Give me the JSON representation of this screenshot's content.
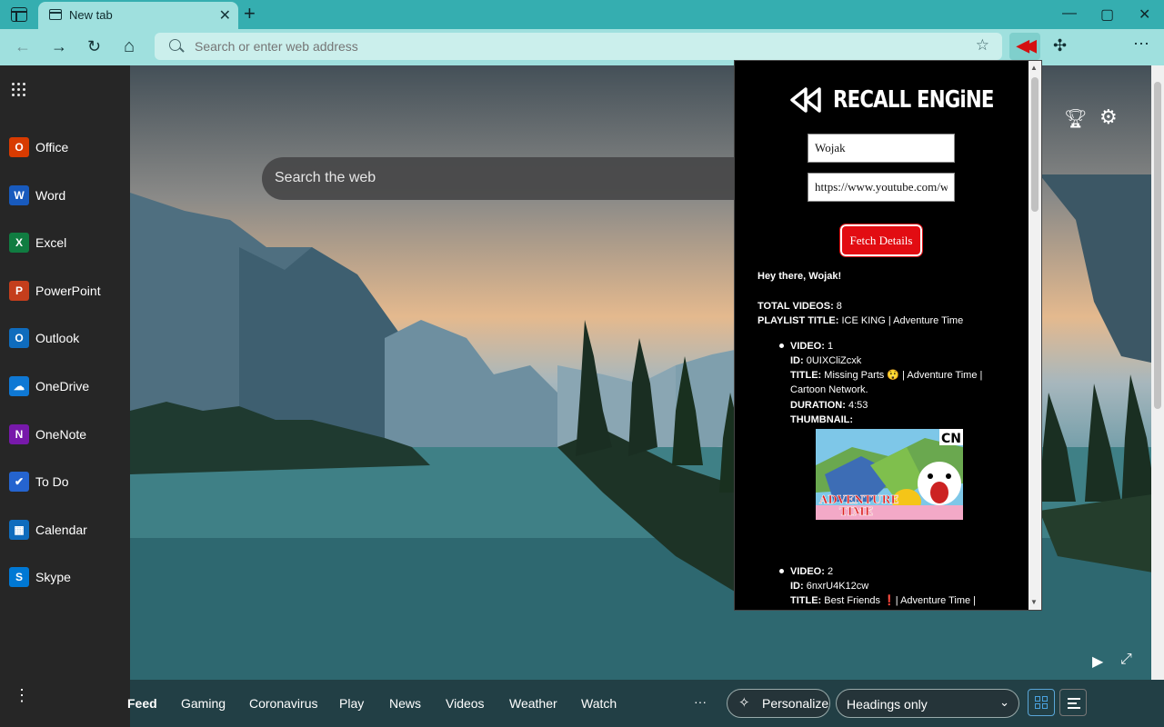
{
  "browser": {
    "tab": {
      "title": "New tab",
      "close": "✕"
    },
    "new_tab": "+",
    "window": {
      "minimize": "—",
      "maximize": "▢",
      "close": "✕"
    },
    "nav": {
      "back": "←",
      "forward": "→",
      "refresh": "↻",
      "home": "⌂"
    },
    "address_placeholder": "Search or enter web address",
    "more": "⋯"
  },
  "sidebar": {
    "apps": [
      {
        "label": "Office",
        "color": "#d83b01",
        "glyph": "O"
      },
      {
        "label": "Word",
        "color": "#185abd",
        "glyph": "W"
      },
      {
        "label": "Excel",
        "color": "#107c41",
        "glyph": "X"
      },
      {
        "label": "PowerPoint",
        "color": "#c43e1c",
        "glyph": "P"
      },
      {
        "label": "Outlook",
        "color": "#0f6cbd",
        "glyph": "O"
      },
      {
        "label": "OneDrive",
        "color": "#0f78d4",
        "glyph": "☁"
      },
      {
        "label": "OneNote",
        "color": "#7719aa",
        "glyph": "N"
      },
      {
        "label": "To Do",
        "color": "#2564cf",
        "glyph": "✔"
      },
      {
        "label": "Calendar",
        "color": "#0f6cbd",
        "glyph": "▦"
      },
      {
        "label": "Skype",
        "color": "#0078d4",
        "glyph": "S"
      }
    ]
  },
  "newtab": {
    "search_placeholder": "Search the web",
    "feed_tabs": [
      "Feed",
      "Gaming",
      "Coronavirus",
      "Play",
      "News",
      "Videos",
      "Weather",
      "Watch"
    ],
    "feed_more": "···",
    "personalize": "Personalize",
    "headings": "Headings only"
  },
  "extension": {
    "brand": "RECALL ENGiNE",
    "name_value": "Wojak",
    "url_value": "https://www.youtube.com/watch?v",
    "fetch_label": "Fetch Details",
    "greeting": "Hey there, Wojak!",
    "total_label": "TOTAL VIDEOS:",
    "total_value": "8",
    "playlist_label": "PLAYLIST TITLE:",
    "playlist_value": "ICE KING | Adventure Time",
    "videos": [
      {
        "video_label": "VIDEO:",
        "video_value": "1",
        "id_label": "ID:",
        "id_value": "0UIXCliZcxk",
        "title_label": "TITLE:",
        "title_line1": "Missing Parts 😲 | Adventure Time |",
        "title_line2": "Cartoon Network.",
        "duration_label": "DURATION:",
        "duration_value": "4:53",
        "thumb_label": "THUMBNAIL:",
        "thumb_badge": "CN",
        "thumb_logo_1": "ADVENTURE",
        "thumb_logo_2": "TIME"
      },
      {
        "video_label": "VIDEO:",
        "video_value": "2",
        "id_label": "ID:",
        "id_value": "6nxrU4K12cw",
        "title_label": "TITLE:",
        "title_line1": "Best Friends ❗| Adventure Time |"
      }
    ]
  }
}
